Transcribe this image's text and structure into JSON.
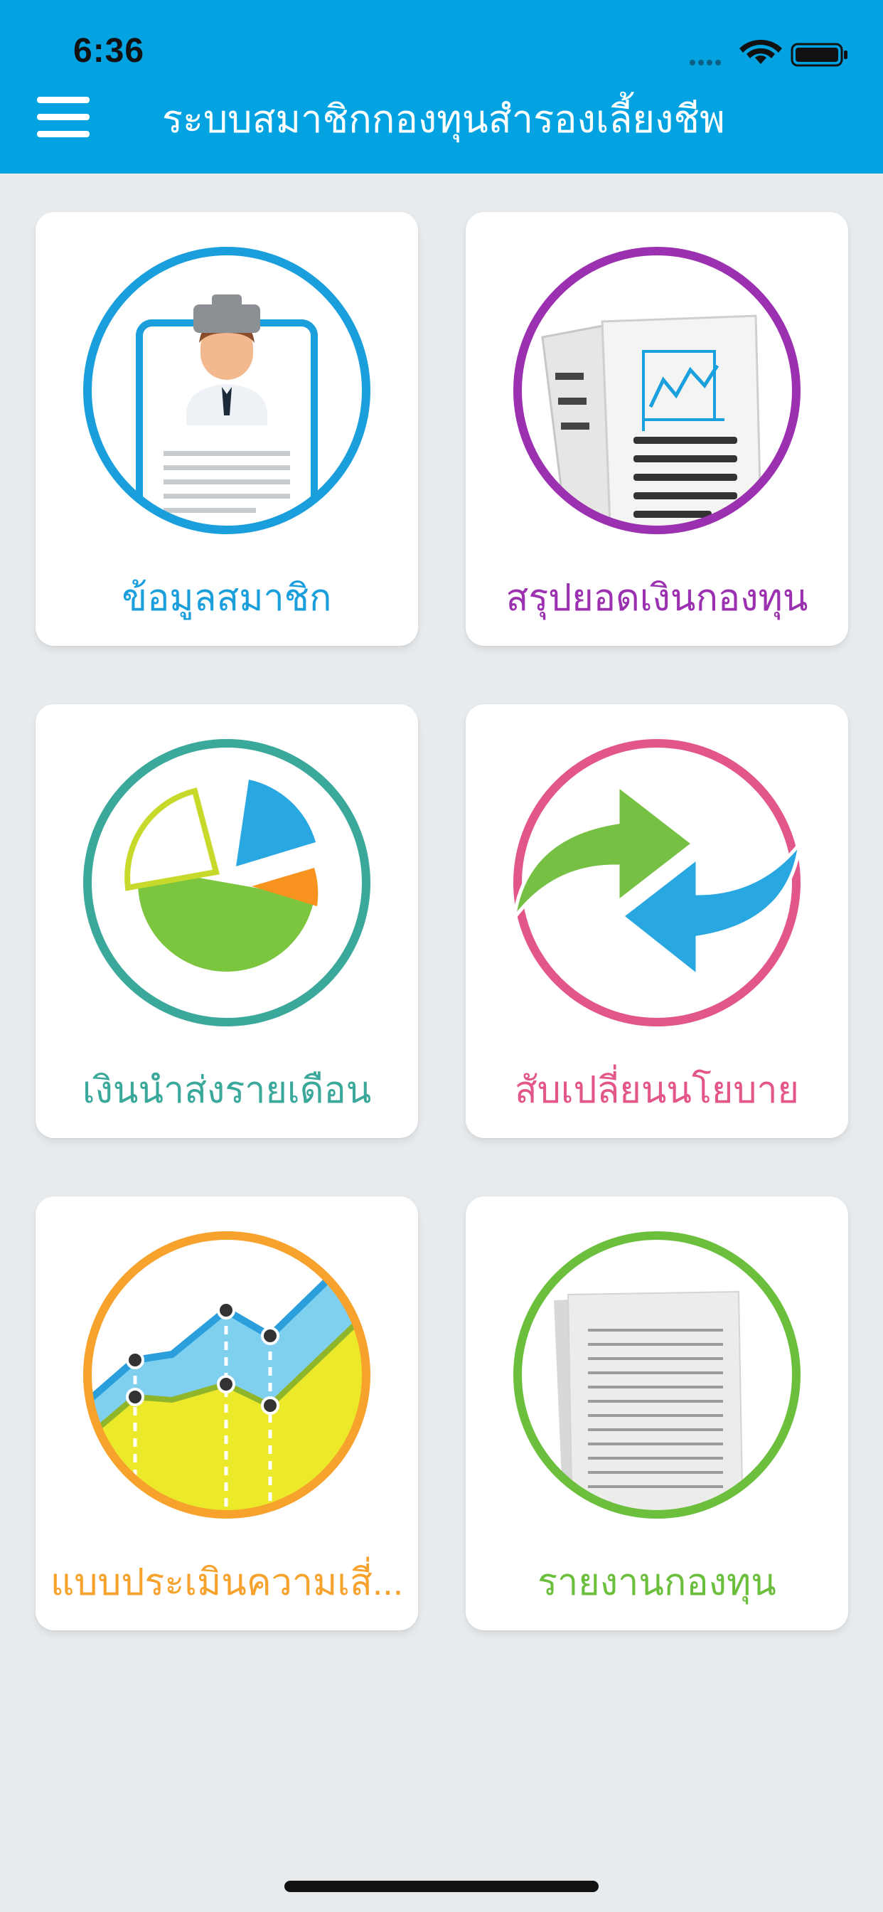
{
  "status_bar": {
    "time": "6:36"
  },
  "header": {
    "title": "ระบบสมาชิกกองทุนสำรองเลี้ยงชีพ",
    "menu_icon": "hamburger-menu-icon"
  },
  "colors": {
    "header_bg": "#03a3e2",
    "page_bg": "#e8ebee",
    "member": "#1a9fdc",
    "summary": "#9b30b0",
    "contribution": "#3aa89a",
    "policy": "#e2568a",
    "risk": "#f7a22c",
    "report": "#6cbf3d"
  },
  "menu": [
    {
      "label": "ข้อมูลสมาชิก",
      "icon": "member-id-card-icon"
    },
    {
      "label": "สรุปยอดเงินกองทุน",
      "icon": "fund-summary-report-icon"
    },
    {
      "label": "เงินนำส่งรายเดือน",
      "icon": "pie-chart-icon"
    },
    {
      "label": "สับเปลี่ยนนโยบาย",
      "icon": "switch-arrows-icon"
    },
    {
      "label": "แบบประเมินความเสี่...",
      "icon": "area-chart-icon"
    },
    {
      "label": "รายงานกองทุน",
      "icon": "document-stack-icon"
    }
  ]
}
